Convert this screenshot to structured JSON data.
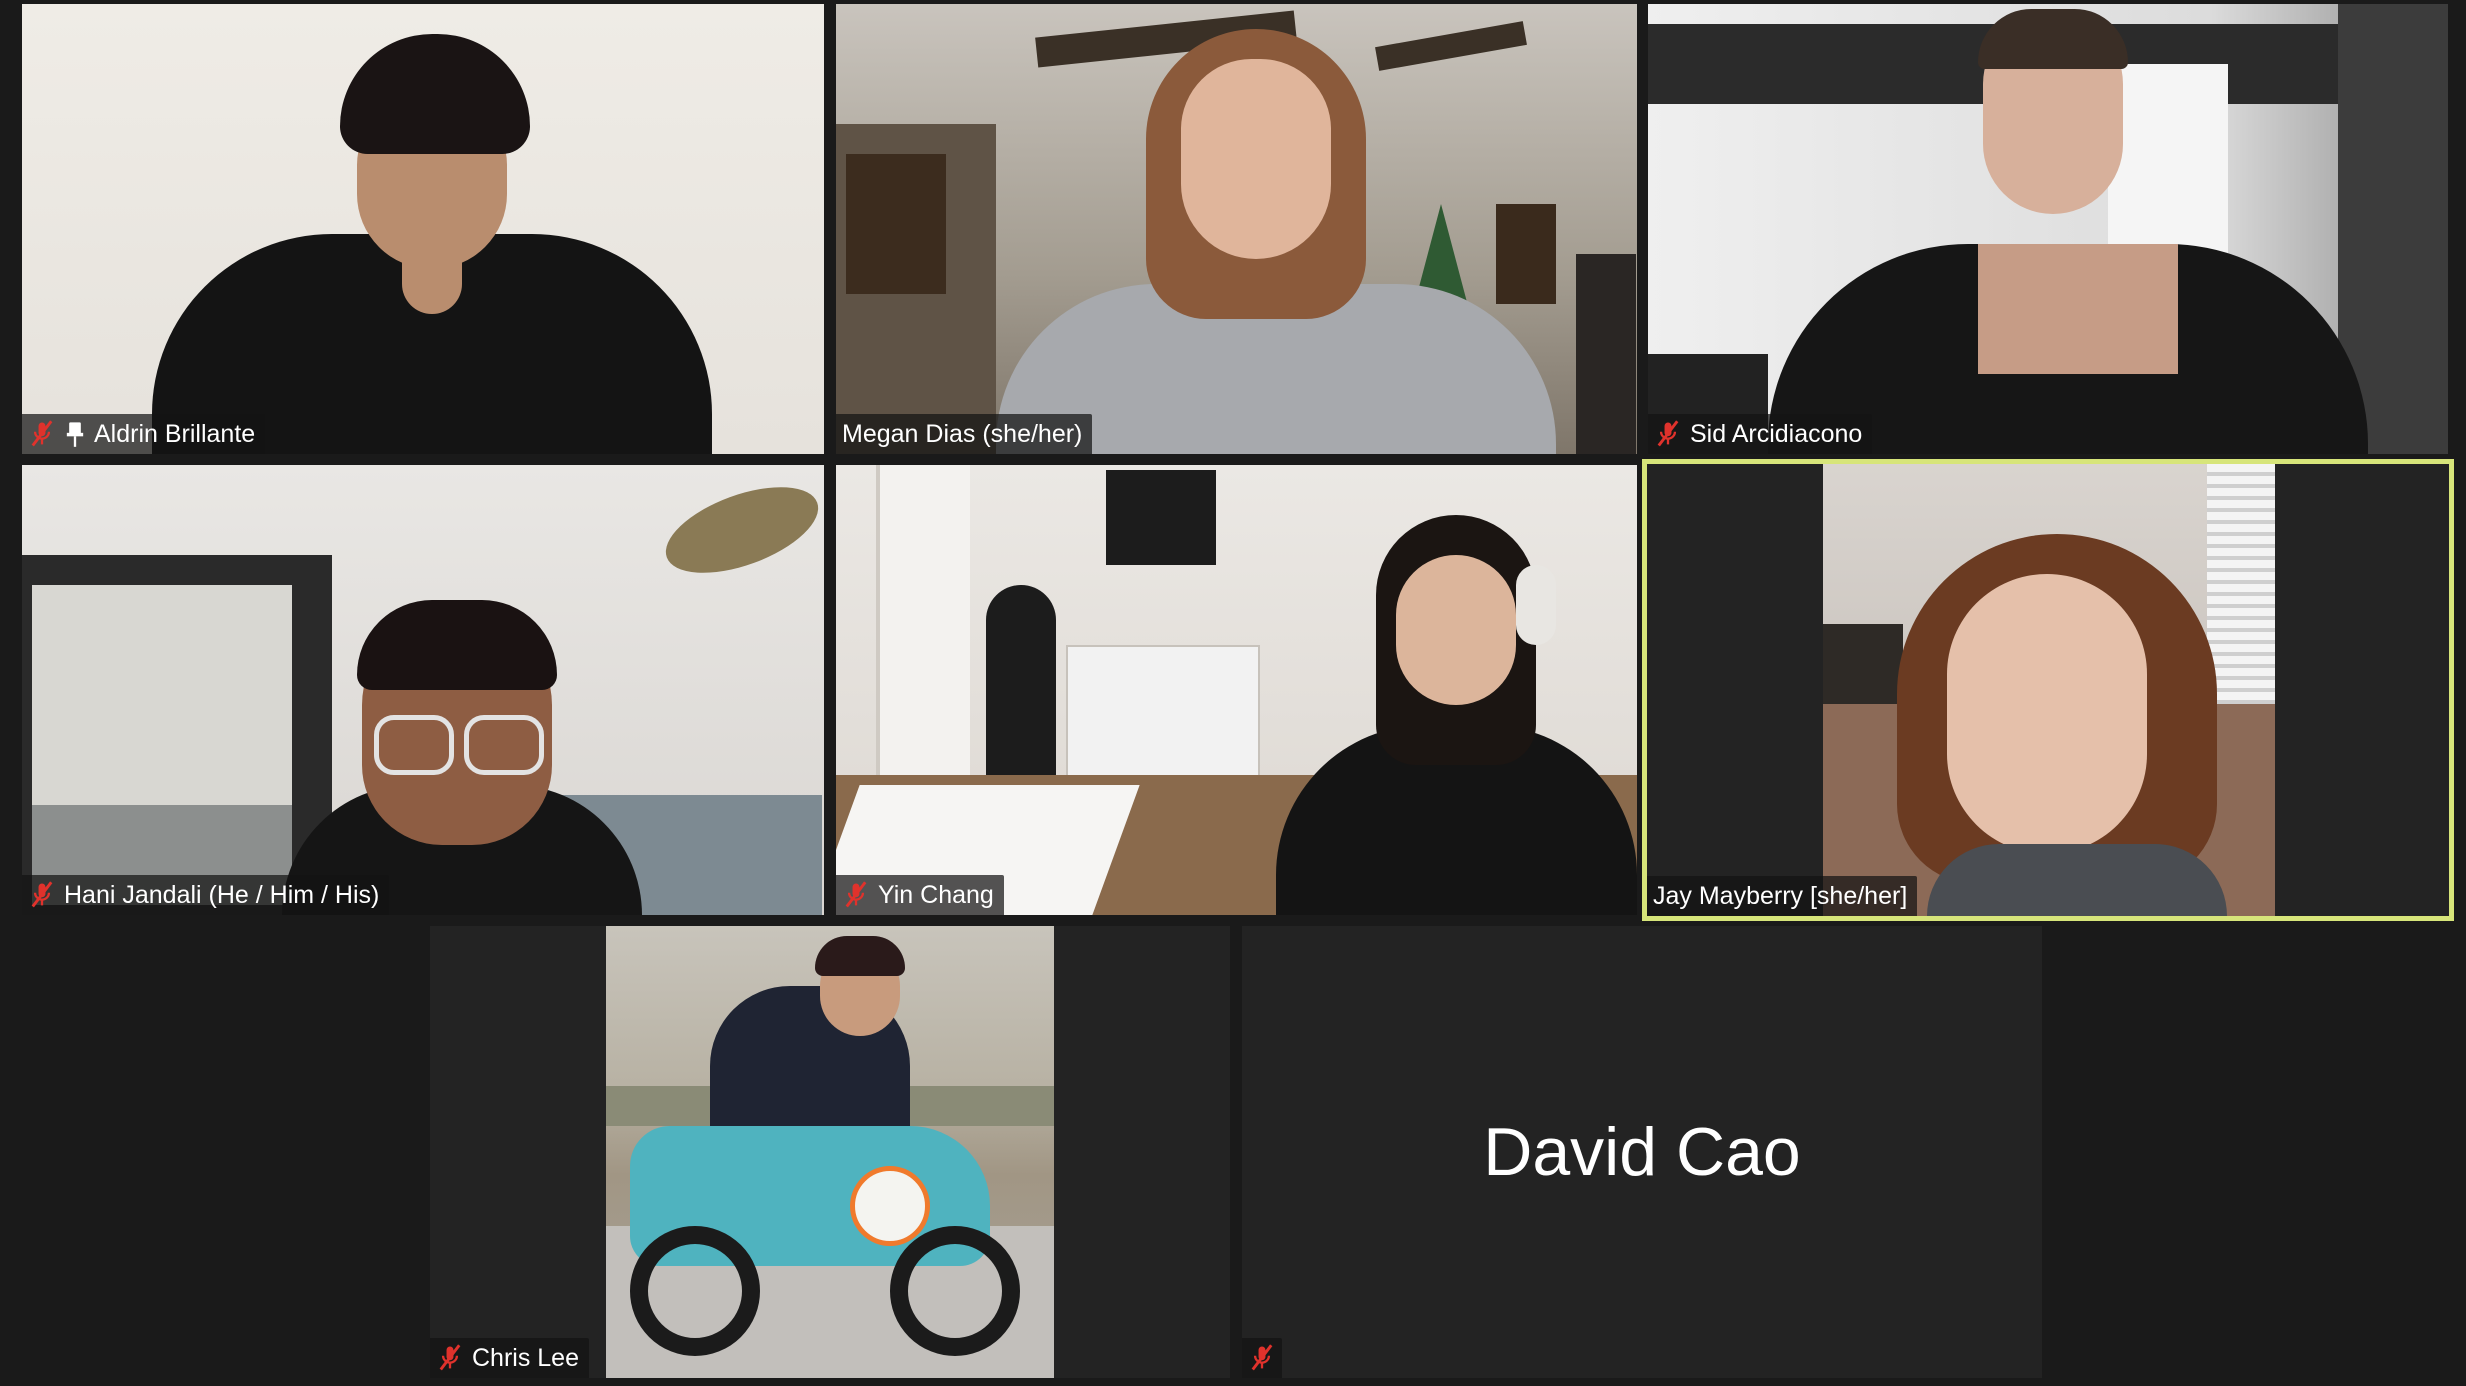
{
  "participants": [
    {
      "name": "Aldrin Brillante",
      "muted": true,
      "pinned": true
    },
    {
      "name": "Megan Dias (she/her)",
      "muted": false,
      "pinned": false
    },
    {
      "name": "Sid Arcidiacono",
      "muted": true,
      "pinned": false
    },
    {
      "name": "Hani Jandali (He / Him / His)",
      "muted": true,
      "pinned": false
    },
    {
      "name": "Yin Chang",
      "muted": true,
      "pinned": false
    },
    {
      "name": "Jay Mayberry [she/her]",
      "muted": false,
      "pinned": false,
      "active_speaker": true
    },
    {
      "name": "Chris Lee",
      "muted": true,
      "pinned": false
    },
    {
      "name": "David Cao",
      "muted": true,
      "pinned": false,
      "video_off": true
    }
  ],
  "icons": {
    "muted": "mic-muted-icon",
    "pinned": "pin-icon"
  },
  "colors": {
    "background": "#1a1a1a",
    "active_border": "#d7e57a",
    "muted_icon": "#e0322c"
  }
}
